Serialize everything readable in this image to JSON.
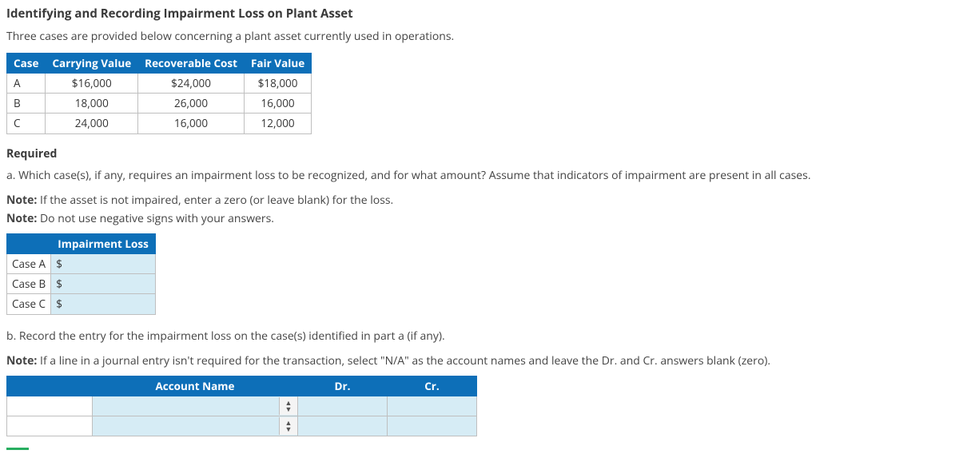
{
  "title": "Identifying and Recording Impairment Loss on Plant Asset",
  "intro": "Three cases are provided below concering a plant asset currently used in operations.",
  "intro_correct": "Three cases are provided below concerning a plant asset currently used in operations.",
  "data_table": {
    "headers": [
      "Case",
      "Carrying Value",
      "Recoverable Cost",
      "Fair Value"
    ],
    "rows": [
      {
        "case": "A",
        "carrying": "$16,000",
        "recoverable": "$24,000",
        "fair": "$18,000"
      },
      {
        "case": "B",
        "carrying": "18,000",
        "recoverable": "26,000",
        "fair": "16,000"
      },
      {
        "case": "C",
        "carrying": "24,000",
        "recoverable": "16,000",
        "fair": "12,000"
      }
    ]
  },
  "required_label": "Required",
  "part_a": "a. Which case(s), if any, requires an impairment loss to be recognized, and for what amount? Assume that indicators of impairment are present in all cases.",
  "note1_prefix": "Note:",
  "note1_text": " If the asset is not impaired, enter a zero (or leave blank) for the loss.",
  "note2_prefix": "Note:",
  "note2_text": " Do not use negative signs with your answers.",
  "imp_table": {
    "header": "Impairment Loss",
    "rows": [
      "Case A",
      "Case B",
      "Case C"
    ],
    "currency": "$"
  },
  "part_b": "b. Record the entry for the impairment loss on the case(s) identified in part a (if any).",
  "note3_prefix": "Note:",
  "note3_text": " If a line in a journal entry isn't required for the transaction, select \"N/A\" as the account names and leave the Dr. and Cr. answers blank (zero).",
  "je_table": {
    "headers": [
      "Account Name",
      "Dr.",
      "Cr."
    ]
  }
}
